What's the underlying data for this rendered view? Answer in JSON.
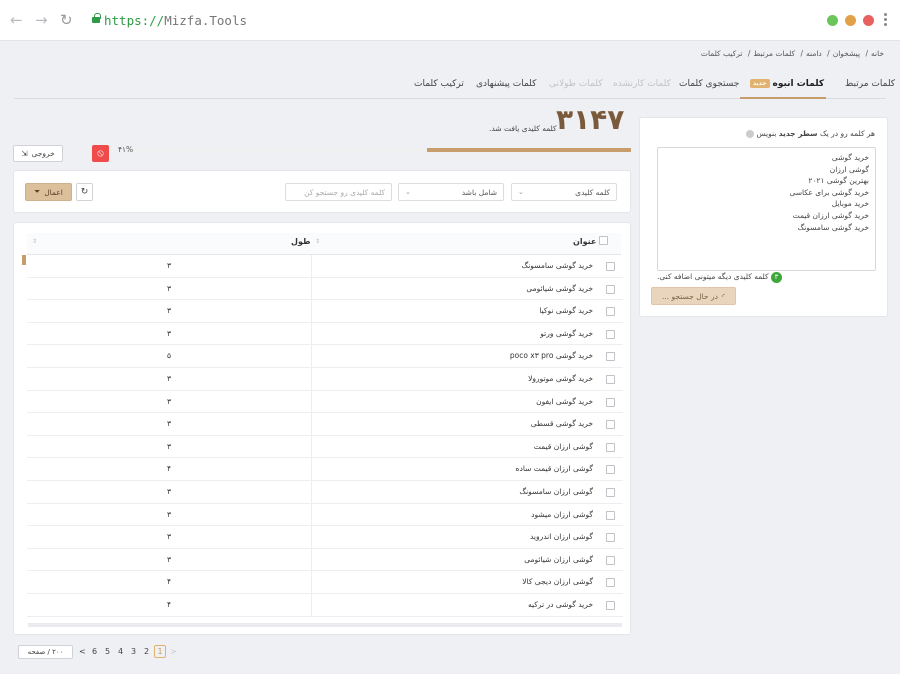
{
  "browser": {
    "url_scheme": "https://",
    "url_host": "Mizfa.Tools",
    "back": "←",
    "forward": "→",
    "reload": "↻"
  },
  "breadcrumb": [
    "خانه",
    "پیشخوان",
    "دامنه",
    "کلمات مرتبط",
    "ترکیب کلمات"
  ],
  "tabs": {
    "related": "کلمات مرتبط",
    "bulk": "کلمات انبوه",
    "bulk_badge": "جدید",
    "search": "جستجوی کلمات",
    "competitor": "کلمات کارنشده",
    "long": "کلمات طولانی",
    "suggested": "کلمات پیشنهادی",
    "combine": "ترکیب کلمات"
  },
  "input_panel": {
    "hint_prefix": "هر کلمه رو در یک",
    "hint_bold": "سطر جدید",
    "hint_suffix": "بنویس",
    "keywords": [
      "خرید گوشی",
      "گوشی ارزان",
      "بهترین گوشی ۲۰۲۱",
      "خرید گوشی برای عکاسی",
      "خرید موبایل",
      "خرید گوشی ارزان قیمت",
      "خرید گوشی سامسونگ"
    ],
    "remaining_count": "۳",
    "remaining_text": "کلمه کلیدی دیگه میتونی اضافه کنی.",
    "search_button": "در حال جستجو ..."
  },
  "results": {
    "count": "۳۱۴۷",
    "count_text": "کلمه کلیدی یافت شد.",
    "progress_label": "۴۱%",
    "progress": 0.41,
    "export": "خروجی",
    "stop_icon": "ban-icon"
  },
  "filters": {
    "field": "کلمه کلیدی",
    "operator": "شامل باشد",
    "value_placeholder": "کلمه کلیدی رو جستجو کن",
    "apply": "اعمال",
    "reset_icon": "refresh-icon"
  },
  "table": {
    "col_title": "عنوان",
    "col_length": "طول",
    "rows": [
      {
        "title": "خرید گوشی سامسونگ",
        "length": "۳"
      },
      {
        "title": "خرید گوشی شیائومی",
        "length": "۳"
      },
      {
        "title": "خرید گوشی نوکیا",
        "length": "۳"
      },
      {
        "title": "خرید گوشی ورتو",
        "length": "۳"
      },
      {
        "title": "خرید گوشی poco x۳ pro",
        "length": "۵"
      },
      {
        "title": "خرید گوشی موتورولا",
        "length": "۳"
      },
      {
        "title": "خرید گوشی ایفون",
        "length": "۳"
      },
      {
        "title": "خرید گوشی قسطی",
        "length": "۳"
      },
      {
        "title": "گوشی ارزان قیمت",
        "length": "۳"
      },
      {
        "title": "گوشی ارزان قیمت ساده",
        "length": "۴"
      },
      {
        "title": "گوشی ارزان سامسونگ",
        "length": "۳"
      },
      {
        "title": "گوشی ارزان میشود",
        "length": "۳"
      },
      {
        "title": "گوشی ارزان اندروید",
        "length": "۳"
      },
      {
        "title": "گوشی ارزان شیائومی",
        "length": "۳"
      },
      {
        "title": "گوشی ارزان دیجی کالا",
        "length": "۴"
      },
      {
        "title": "خرید گوشی در ترکیه",
        "length": "۴"
      }
    ]
  },
  "pagination": {
    "per_page": "۲۰۰ / صفحه",
    "pages": [
      "6",
      "5",
      "4",
      "3",
      "2",
      "1"
    ],
    "current": "1",
    "prev": "<",
    "next": ">"
  },
  "colors": {
    "accent": "#c89d6c",
    "count": "#7a5a3a",
    "green": "#3fa63a",
    "danger": "#ef4b4b"
  }
}
